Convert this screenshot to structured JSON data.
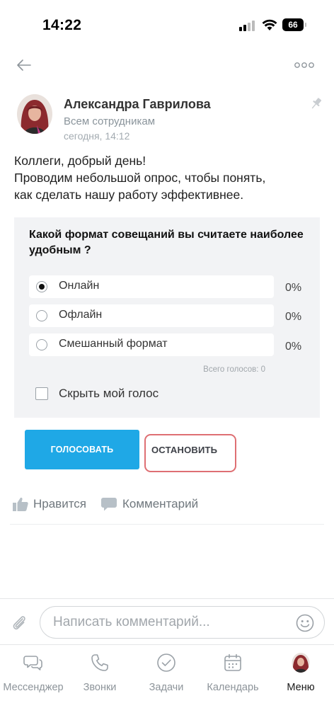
{
  "status_bar": {
    "time": "14:22",
    "battery": "66"
  },
  "header": {
    "back_icon": "arrow-left-icon",
    "more_icon": "more-dots-icon"
  },
  "post": {
    "author": "Александра Гаврилова",
    "audience": "Всем сотрудникам",
    "date": "сегодня, 14:12",
    "pinned_icon": "pin-icon",
    "text_lines": [
      "Коллеги, добрый день!",
      "Проводим небольшой опрос, чтобы понять,",
      "как сделать нашу работу эффективнее."
    ]
  },
  "poll": {
    "question": "Какой формат совещаний вы считаете наиболее удобным ?",
    "options": [
      {
        "label": "Онлайн",
        "percent": "0%",
        "selected": true
      },
      {
        "label": "Офлайн",
        "percent": "0%",
        "selected": false
      },
      {
        "label": "Смешанный формат",
        "percent": "0%",
        "selected": false
      }
    ],
    "votes_total": "Всего голосов: 0",
    "hide_vote_label": "Скрыть мой голос",
    "hide_vote_checked": false
  },
  "actions": {
    "vote_label": "ГОЛОСОВАТЬ",
    "stop_label": "ОСТАНОВИТЬ",
    "vote_color": "#1fa8e6",
    "stop_highlight_color": "#de6f73"
  },
  "reactions": {
    "like_label": "Нравится",
    "comment_label": "Комментарий"
  },
  "comment_bar": {
    "placeholder": "Написать комментарий...",
    "attach_icon": "paperclip-icon",
    "emoji_icon": "smile-icon"
  },
  "tabbar": {
    "items": [
      {
        "label": "Мессенджер",
        "icon": "chat-icon"
      },
      {
        "label": "Звонки",
        "icon": "phone-icon"
      },
      {
        "label": "Задачи",
        "icon": "check-circle-icon"
      },
      {
        "label": "Календарь",
        "icon": "calendar-icon"
      },
      {
        "label": "Меню",
        "icon": "avatar-icon",
        "active": true
      }
    ]
  }
}
